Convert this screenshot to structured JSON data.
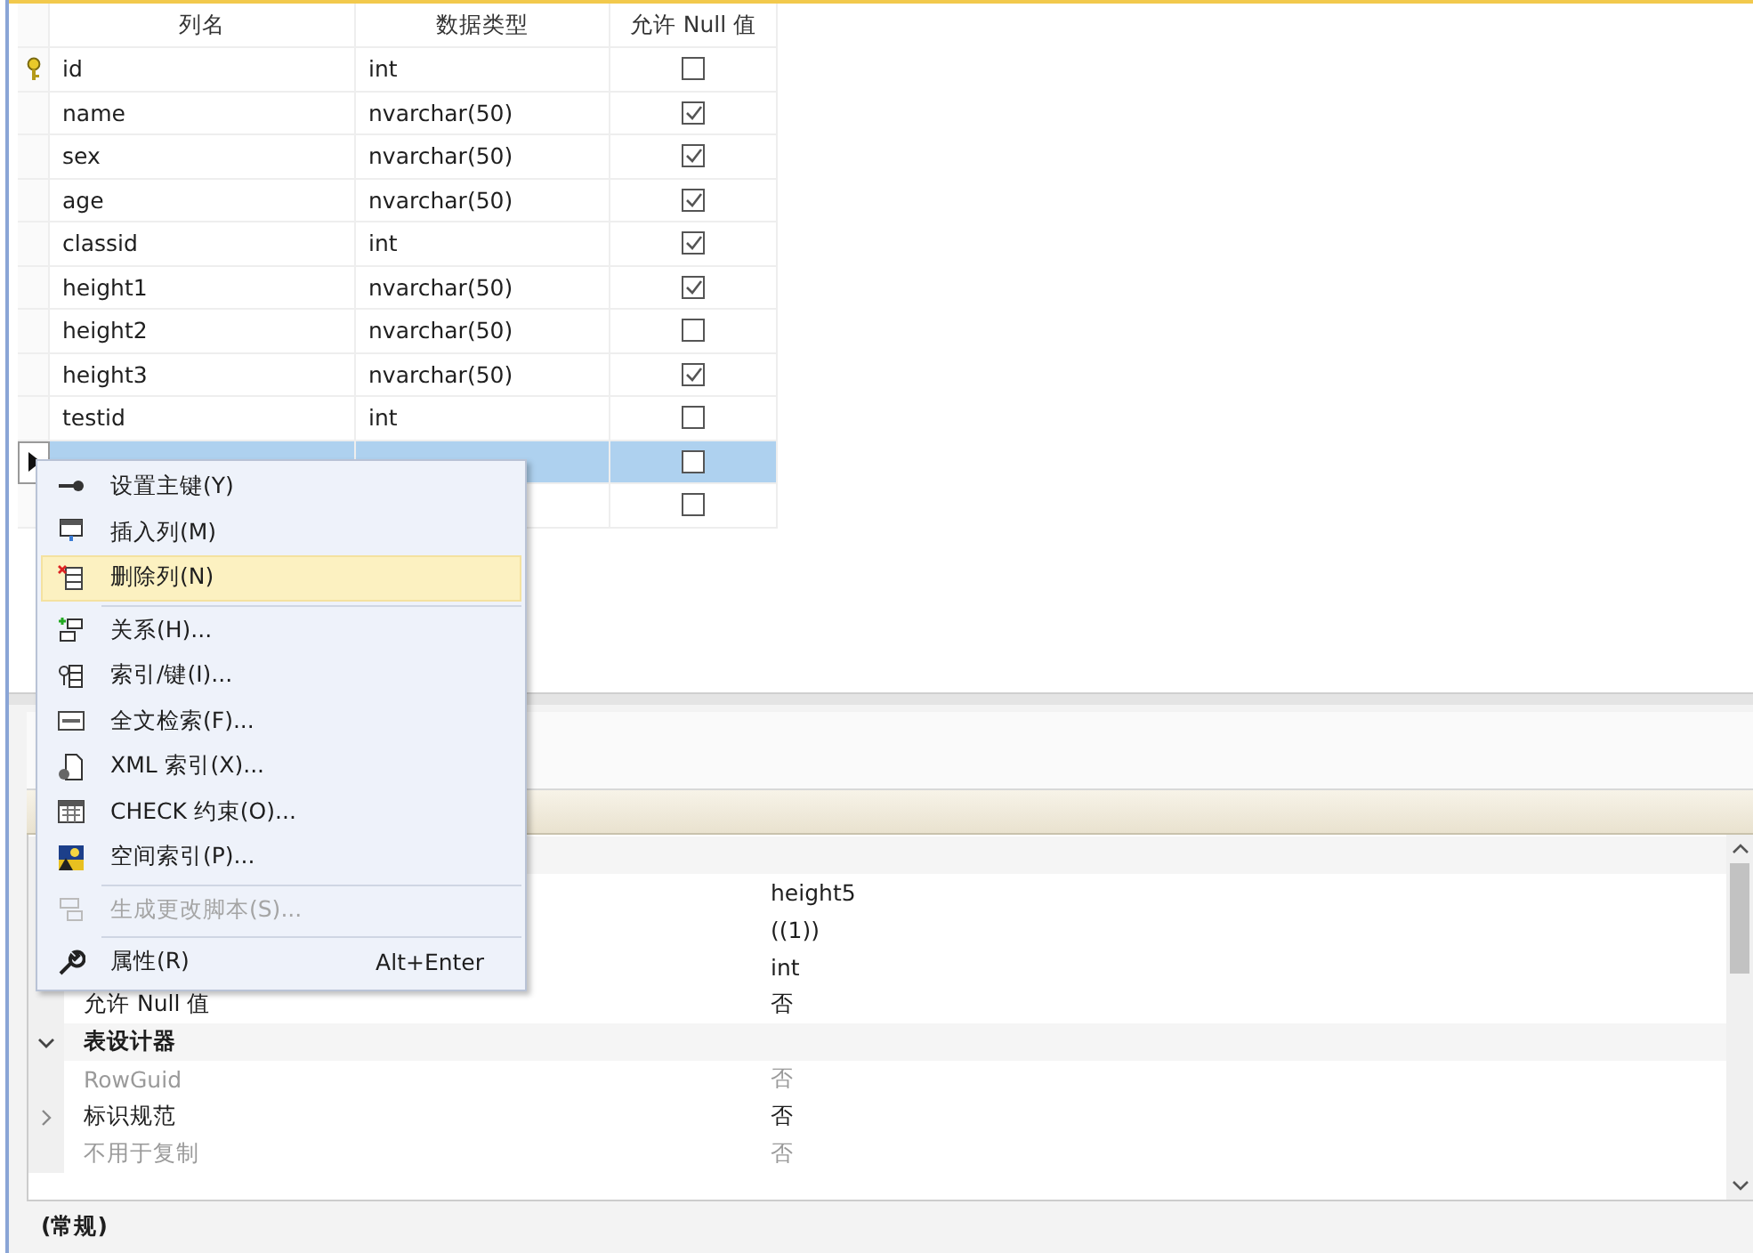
{
  "grid": {
    "columns": [
      "列名",
      "数据类型",
      "允许 Null 值"
    ],
    "rows": [
      {
        "name": "id",
        "type": "int",
        "allow_null": false,
        "primary_key": true,
        "selected": false
      },
      {
        "name": "name",
        "type": "nvarchar(50)",
        "allow_null": true,
        "primary_key": false,
        "selected": false
      },
      {
        "name": "sex",
        "type": "nvarchar(50)",
        "allow_null": true,
        "primary_key": false,
        "selected": false
      },
      {
        "name": "age",
        "type": "nvarchar(50)",
        "allow_null": true,
        "primary_key": false,
        "selected": false
      },
      {
        "name": "classid",
        "type": "int",
        "allow_null": true,
        "primary_key": false,
        "selected": false
      },
      {
        "name": "height1",
        "type": "nvarchar(50)",
        "allow_null": true,
        "primary_key": false,
        "selected": false
      },
      {
        "name": "height2",
        "type": "nvarchar(50)",
        "allow_null": false,
        "primary_key": false,
        "selected": false
      },
      {
        "name": "height3",
        "type": "nvarchar(50)",
        "allow_null": true,
        "primary_key": false,
        "selected": false
      },
      {
        "name": "testid",
        "type": "int",
        "allow_null": false,
        "primary_key": false,
        "selected": false
      },
      {
        "allow_null": false,
        "primary_key": false,
        "selected": true
      },
      {
        "allow_null": false,
        "primary_key": false,
        "selected": false
      }
    ]
  },
  "context_menu": {
    "items": [
      {
        "kind": "item",
        "label": "设置主键(Y)",
        "highlighted": false,
        "disabled": false
      },
      {
        "kind": "item",
        "label": "插入列(M)",
        "highlighted": false,
        "disabled": false
      },
      {
        "kind": "item",
        "label": "删除列(N)",
        "highlighted": true,
        "disabled": false
      },
      {
        "kind": "separator"
      },
      {
        "kind": "item",
        "label": "关系(H)...",
        "highlighted": false,
        "disabled": false
      },
      {
        "kind": "item",
        "label": "索引/键(I)...",
        "highlighted": false,
        "disabled": false
      },
      {
        "kind": "item",
        "label": "全文检索(F)...",
        "highlighted": false,
        "disabled": false
      },
      {
        "kind": "item",
        "label": "XML 索引(X)...",
        "highlighted": false,
        "disabled": false
      },
      {
        "kind": "item",
        "label": "CHECK 约束(O)...",
        "highlighted": false,
        "disabled": false
      },
      {
        "kind": "item",
        "label": "空间索引(P)...",
        "highlighted": false,
        "disabled": false
      },
      {
        "kind": "separator"
      },
      {
        "kind": "item",
        "label": "生成更改脚本(S)...",
        "highlighted": false,
        "disabled": true
      },
      {
        "kind": "separator"
      },
      {
        "kind": "item",
        "label": "属性(R)",
        "shortcut": "Alt+Enter",
        "highlighted": false,
        "disabled": false
      }
    ]
  },
  "properties": {
    "rows": [
      {
        "kind": "category"
      },
      {
        "kind": "property",
        "value": "height5",
        "disabled": false
      },
      {
        "kind": "property",
        "value": "((1))",
        "disabled": false
      },
      {
        "kind": "property",
        "value": "int",
        "disabled": false
      },
      {
        "kind": "property",
        "label": "允许 Null 值",
        "value": "否",
        "disabled": false
      },
      {
        "kind": "category",
        "label": "表设计器",
        "expanded": true
      },
      {
        "kind": "property",
        "label": "RowGuid",
        "value": "否",
        "disabled": true
      },
      {
        "kind": "property",
        "label": "标识规范",
        "value": "否",
        "disabled": false,
        "expanded": false
      },
      {
        "kind": "property",
        "label": "不用于复制",
        "value": "否",
        "disabled": true
      }
    ],
    "description": "(常规)"
  }
}
